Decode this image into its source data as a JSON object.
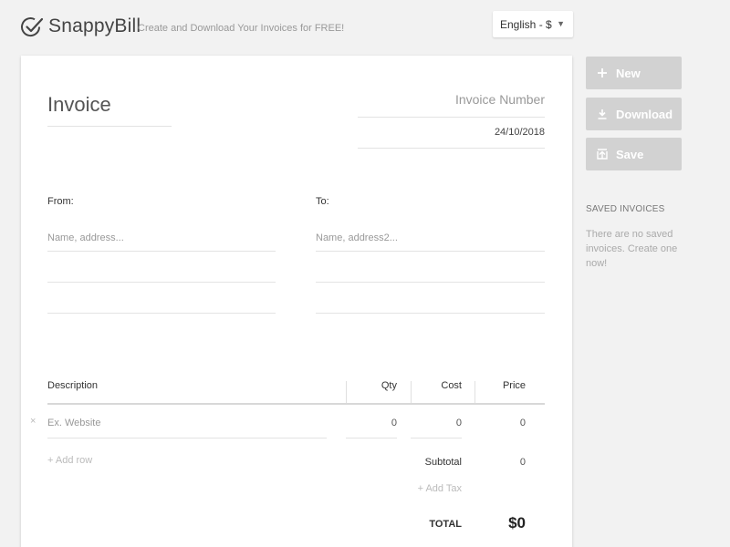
{
  "header": {
    "brand_name": "SnappyBill",
    "tagline": "Create and Download Your Invoices for FREE!",
    "language": "English - $",
    "brand_icon": "check-circle-icon"
  },
  "invoice": {
    "title": "Invoice",
    "number_placeholder": "Invoice Number",
    "date": "24/10/2018",
    "from_label": "From:",
    "to_label": "To:",
    "from_placeholder": "Name, address...",
    "to_placeholder": "Name, address2..."
  },
  "table": {
    "headers": {
      "description": "Description",
      "qty": "Qty",
      "cost": "Cost",
      "price": "Price"
    },
    "rows": [
      {
        "remove": "×",
        "description_placeholder": "Ex. Website",
        "qty": "0",
        "cost": "0",
        "price": "0"
      }
    ],
    "add_row": "+ Add row",
    "subtotal_label": "Subtotal",
    "subtotal_value": "0",
    "add_tax": "+ Add Tax",
    "total_label": "TOTAL",
    "total_value": "$0"
  },
  "sidebar": {
    "buttons": [
      {
        "label": "New",
        "icon": "plus-icon"
      },
      {
        "label": "Download",
        "icon": "download-icon"
      },
      {
        "label": "Save",
        "icon": "upload-icon"
      }
    ],
    "saved_title": "SAVED INVOICES",
    "saved_empty": "There are no saved invoices. Create one now!"
  },
  "colors": {
    "background": "#f2f2f2",
    "paper": "#ffffff",
    "button_disabled": "#d2d2d2"
  }
}
